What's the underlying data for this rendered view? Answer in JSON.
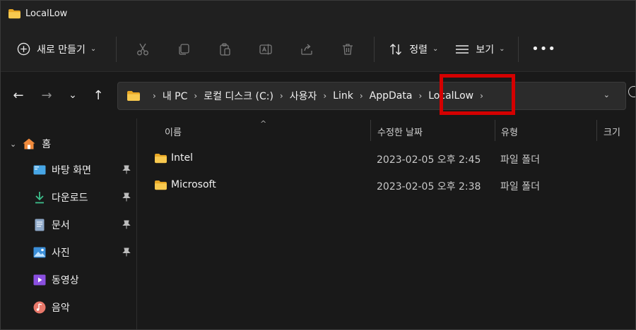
{
  "window": {
    "title": "LocalLow"
  },
  "toolbar": {
    "new_label": "새로 만들기",
    "sort_label": "정렬",
    "view_label": "보기",
    "more_label": "•••",
    "icons": [
      "cut-icon",
      "copy-icon",
      "paste-icon",
      "rename-icon",
      "share-icon",
      "delete-icon"
    ]
  },
  "address": {
    "crumbs": [
      "내 PC",
      "로컬 디스크 (C:)",
      "사용자",
      "Link",
      "AppData",
      "LocalLow"
    ],
    "highlight_color": "#d40000"
  },
  "sidebar": {
    "home_label": "홈",
    "items": [
      {
        "label": "바탕 화면",
        "icon": "desktop-icon",
        "pinned": true
      },
      {
        "label": "다운로드",
        "icon": "download-icon",
        "pinned": true
      },
      {
        "label": "문서",
        "icon": "document-icon",
        "pinned": true
      },
      {
        "label": "사진",
        "icon": "pictures-icon",
        "pinned": true
      },
      {
        "label": "동영상",
        "icon": "videos-icon",
        "pinned": false
      },
      {
        "label": "음악",
        "icon": "music-icon",
        "pinned": false
      }
    ]
  },
  "columns": {
    "name": "이름",
    "date": "수정한 날짜",
    "type": "유형",
    "size": "크기"
  },
  "files": [
    {
      "name": "Intel",
      "date": "2023-02-05 오후 2:45",
      "type": "파일 폴더"
    },
    {
      "name": "Microsoft",
      "date": "2023-02-05 오후 2:38",
      "type": "파일 폴더"
    }
  ],
  "colors": {
    "accent_folder": "#f5c24a",
    "background": "#191919",
    "toolbar": "#202020"
  }
}
